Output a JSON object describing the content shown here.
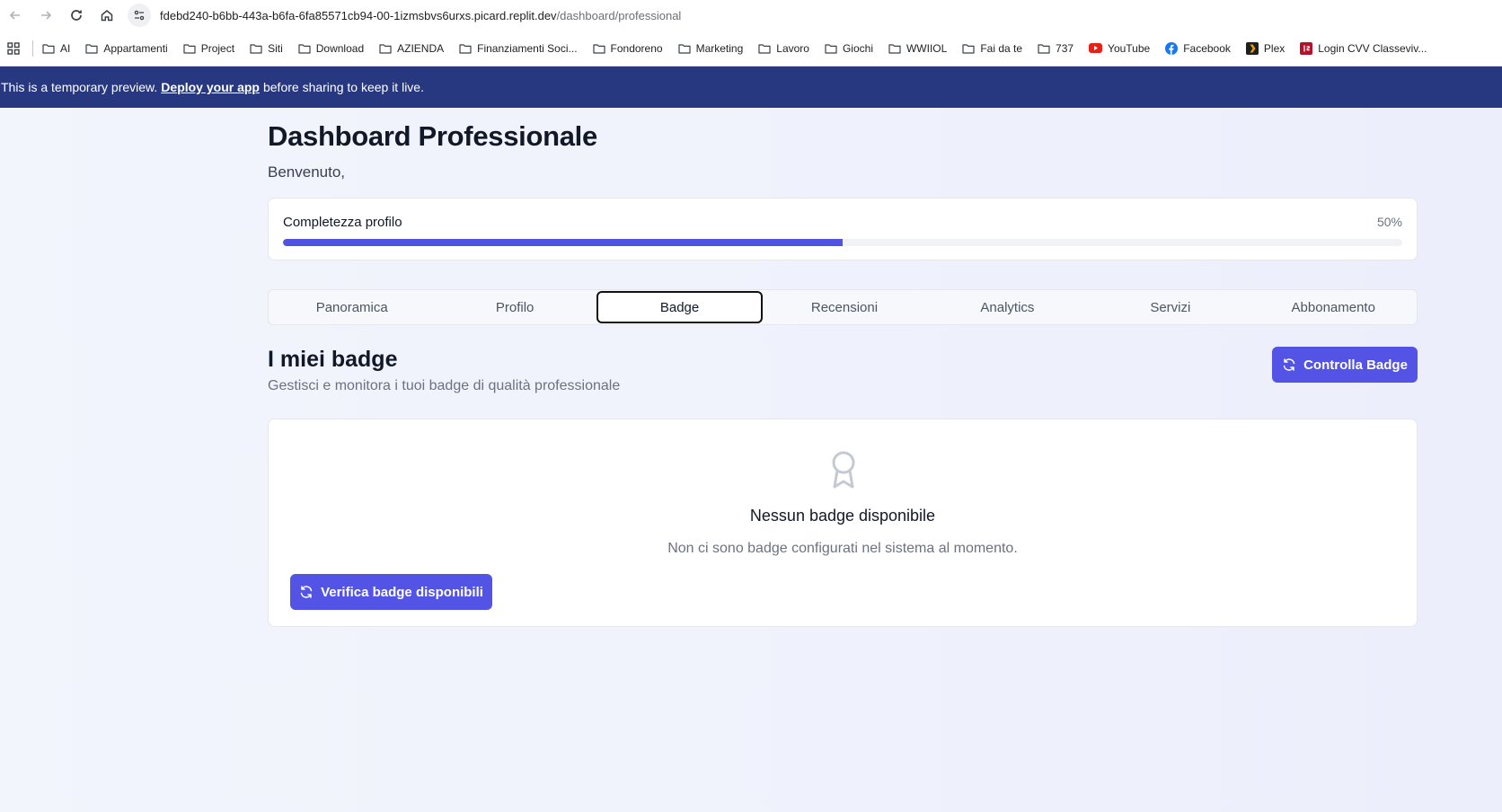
{
  "browser": {
    "url_host": "fdebd240-b6bb-443a-b6fa-6fa85571cb94-00-1izmsbvs6urxs.picard.replit.dev",
    "url_path": "/dashboard/professional",
    "bookmarks": [
      {
        "label": "AI",
        "icon": "folder-icon"
      },
      {
        "label": "Appartamenti",
        "icon": "folder-icon"
      },
      {
        "label": "Project",
        "icon": "folder-icon"
      },
      {
        "label": "Siti",
        "icon": "folder-icon"
      },
      {
        "label": "Download",
        "icon": "folder-icon"
      },
      {
        "label": "AZIENDA",
        "icon": "folder-icon"
      },
      {
        "label": "Finanziamenti Soci...",
        "icon": "folder-icon"
      },
      {
        "label": "Fondoreno",
        "icon": "folder-icon"
      },
      {
        "label": "Marketing",
        "icon": "folder-icon"
      },
      {
        "label": "Lavoro",
        "icon": "folder-icon"
      },
      {
        "label": "Giochi",
        "icon": "folder-icon"
      },
      {
        "label": "WWIIOL",
        "icon": "folder-icon"
      },
      {
        "label": "Fai da te",
        "icon": "folder-icon"
      },
      {
        "label": "737",
        "icon": "folder-icon"
      },
      {
        "label": "YouTube",
        "icon": "youtube-icon"
      },
      {
        "label": "Facebook",
        "icon": "facebook-icon"
      },
      {
        "label": "Plex",
        "icon": "plex-icon"
      },
      {
        "label": "Login CVV Classeviv...",
        "icon": "classeviva-icon"
      }
    ]
  },
  "banner": {
    "text_before": "This is a temporary preview.",
    "link": "Deploy your app",
    "text_after": "before sharing to keep it live."
  },
  "header": {
    "title": "Dashboard Professionale",
    "welcome": "Benvenuto,"
  },
  "profile_progress": {
    "label": "Completezza profilo",
    "value_text": "50%",
    "value": 0.5
  },
  "tabs": [
    {
      "label": "Panoramica"
    },
    {
      "label": "Profilo"
    },
    {
      "label": "Badge",
      "active": true
    },
    {
      "label": "Recensioni"
    },
    {
      "label": "Analytics"
    },
    {
      "label": "Servizi"
    },
    {
      "label": "Abbonamento"
    }
  ],
  "badges": {
    "title": "I miei badge",
    "subtitle": "Gestisci e monitora i tuoi badge di qualità professionale",
    "check_button": "Controlla Badge",
    "empty_title": "Nessun badge disponibile",
    "empty_desc": "Non ci sono badge configurati nel sistema al momento.",
    "verify_button": "Verifica badge disponibili"
  },
  "colors": {
    "primary": "#5353e6",
    "banner": "#273880",
    "progress_fill": "#4f53e2"
  }
}
